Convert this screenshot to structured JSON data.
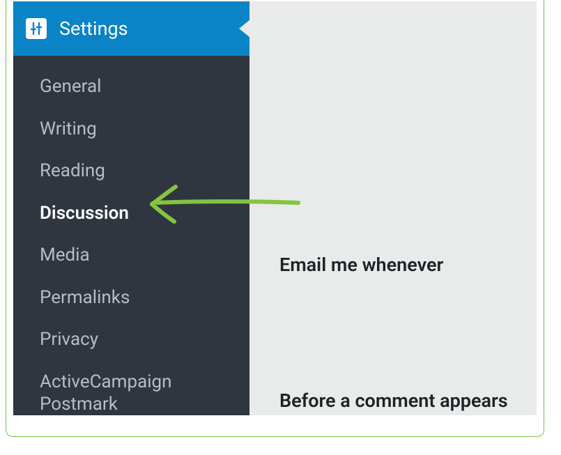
{
  "sidebar": {
    "header": "Settings",
    "items": [
      {
        "label": "General",
        "active": false
      },
      {
        "label": "Writing",
        "active": false
      },
      {
        "label": "Reading",
        "active": false
      },
      {
        "label": "Discussion",
        "active": true
      },
      {
        "label": "Media",
        "active": false
      },
      {
        "label": "Permalinks",
        "active": false
      },
      {
        "label": "Privacy",
        "active": false
      },
      {
        "label": "ActiveCampaign Postmark",
        "active": false
      }
    ]
  },
  "main": {
    "heading1": "Email me whenever",
    "heading2": "Before a comment appears"
  },
  "annotation": {
    "arrow_color": "#84c440"
  }
}
